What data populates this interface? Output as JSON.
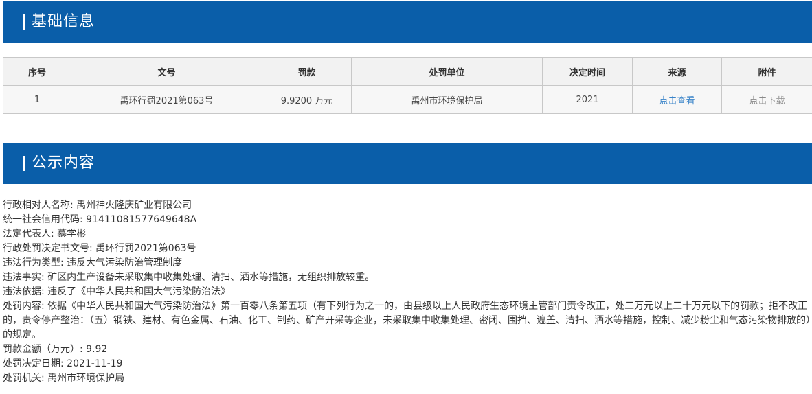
{
  "basic_section": {
    "title": "基础信息"
  },
  "table": {
    "headers": [
      "序号",
      "文号",
      "罚款",
      "处罚单位",
      "决定时间",
      "来源",
      "附件"
    ],
    "rows": [
      {
        "index": "1",
        "doc_number": "禹环行罚2021第063号",
        "fine": "9.9200 万元",
        "unit": "禹州市环境保护局",
        "decision_time": "2021",
        "source": "点击查看",
        "attachment": "点击下载"
      }
    ],
    "link_color": "#3a84c9",
    "download_color": "#8a8a8a"
  },
  "public_section": {
    "title": "公示内容"
  },
  "content": {
    "lines": [
      "行政相对人名称: 禹州神火隆庆矿业有限公司",
      "统一社会信用代码: 91411081577649648A",
      "法定代表人: 慕学彬",
      "行政处罚决定书文号: 禹环行罚2021第063号",
      "违法行为类型: 违反大气污染防治管理制度",
      "违法事实: 矿区内生产设备未采取集中收集处理、清扫、洒水等措施，无组织排放较重。",
      "违法依据: 违反了《中华人民共和国大气污染防治法》",
      "处罚内容: 依据《中华人民共和国大气污染防治法》第一百零八条第五项（有下列行为之一的，由县级以上人民政府生态环境主管部门责令改正，处二万元以上二十万元以下的罚款；拒不改正的，责令停产整治：（五）钢铁、建材、有色金属、石油、化工、制药、矿产开采等企业，未采取集中收集处理、密闭、围挡、遮盖、清扫、洒水等措施，控制、减少粉尘和气态污染物排放的）的规定。",
      "罚款金额（万元）: 9.92",
      "处罚决定日期: 2021-11-19",
      "处罚机关: 禹州市环境保护局"
    ]
  },
  "colors": {
    "header_bg": "#0a5ea9"
  }
}
